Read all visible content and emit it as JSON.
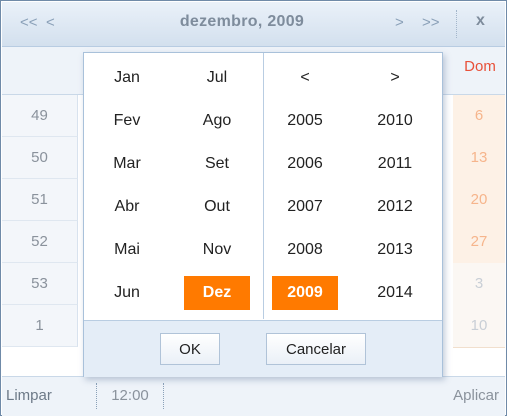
{
  "header": {
    "prev_year": "<<",
    "prev_month": "<",
    "title": "dezembro, 2009",
    "next_month": ">",
    "next_year": ">>",
    "close": "x"
  },
  "day_header": {
    "sunday": "Dom"
  },
  "weeks": [
    {
      "number": "49",
      "sunday": "6",
      "sunday_other_month": false
    },
    {
      "number": "50",
      "sunday": "13",
      "sunday_other_month": false
    },
    {
      "number": "51",
      "sunday": "20",
      "sunday_other_month": false
    },
    {
      "number": "52",
      "sunday": "27",
      "sunday_other_month": false
    },
    {
      "number": "53",
      "sunday": "3",
      "sunday_other_month": true
    },
    {
      "number": "1",
      "sunday": "10",
      "sunday_other_month": true
    }
  ],
  "footer": {
    "clear": "Limpar",
    "time": "12:00",
    "apply": "Aplicar"
  },
  "popup": {
    "months": [
      "Jan",
      "Fev",
      "Mar",
      "Abr",
      "Mai",
      "Jun",
      "Jul",
      "Ago",
      "Set",
      "Out",
      "Nov",
      "Dez"
    ],
    "selected_month": "Dez",
    "year_prev": "<",
    "year_next": ">",
    "years": [
      "2005",
      "2006",
      "2007",
      "2008",
      "2009",
      "2010",
      "2011",
      "2012",
      "2013",
      "2014"
    ],
    "selected_year": "2009",
    "ok": "OK",
    "cancel": "Cancelar"
  },
  "colors": {
    "selected": "#ff7a00",
    "sunday_text": "#e8513a"
  }
}
